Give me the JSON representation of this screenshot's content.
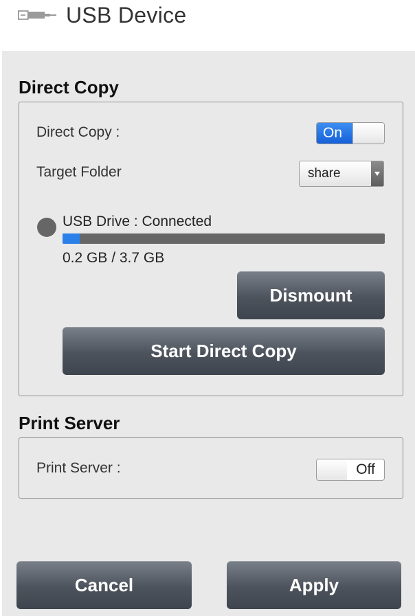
{
  "header": {
    "icon": "usb-plug-icon",
    "title": "USB Device"
  },
  "direct_copy": {
    "section_title": "Direct Copy",
    "toggle_label": "Direct Copy :",
    "toggle_state": "On",
    "target_folder_label": "Target Folder",
    "target_folder_value": "share",
    "drive_status": "USB Drive : Connected",
    "usage_text": "0.2 GB / 3.7 GB",
    "usage_fraction": 0.054,
    "dismount_label": "Dismount",
    "start_label": "Start Direct Copy"
  },
  "print_server": {
    "section_title": "Print Server",
    "toggle_label": "Print Server :",
    "toggle_state": "Off"
  },
  "footer": {
    "cancel_label": "Cancel",
    "apply_label": "Apply"
  },
  "colors": {
    "accent": "#1f6fe0",
    "panel_bg": "#e9e9e9",
    "button_dark": "#4d535c",
    "status_dot": "#666666"
  }
}
